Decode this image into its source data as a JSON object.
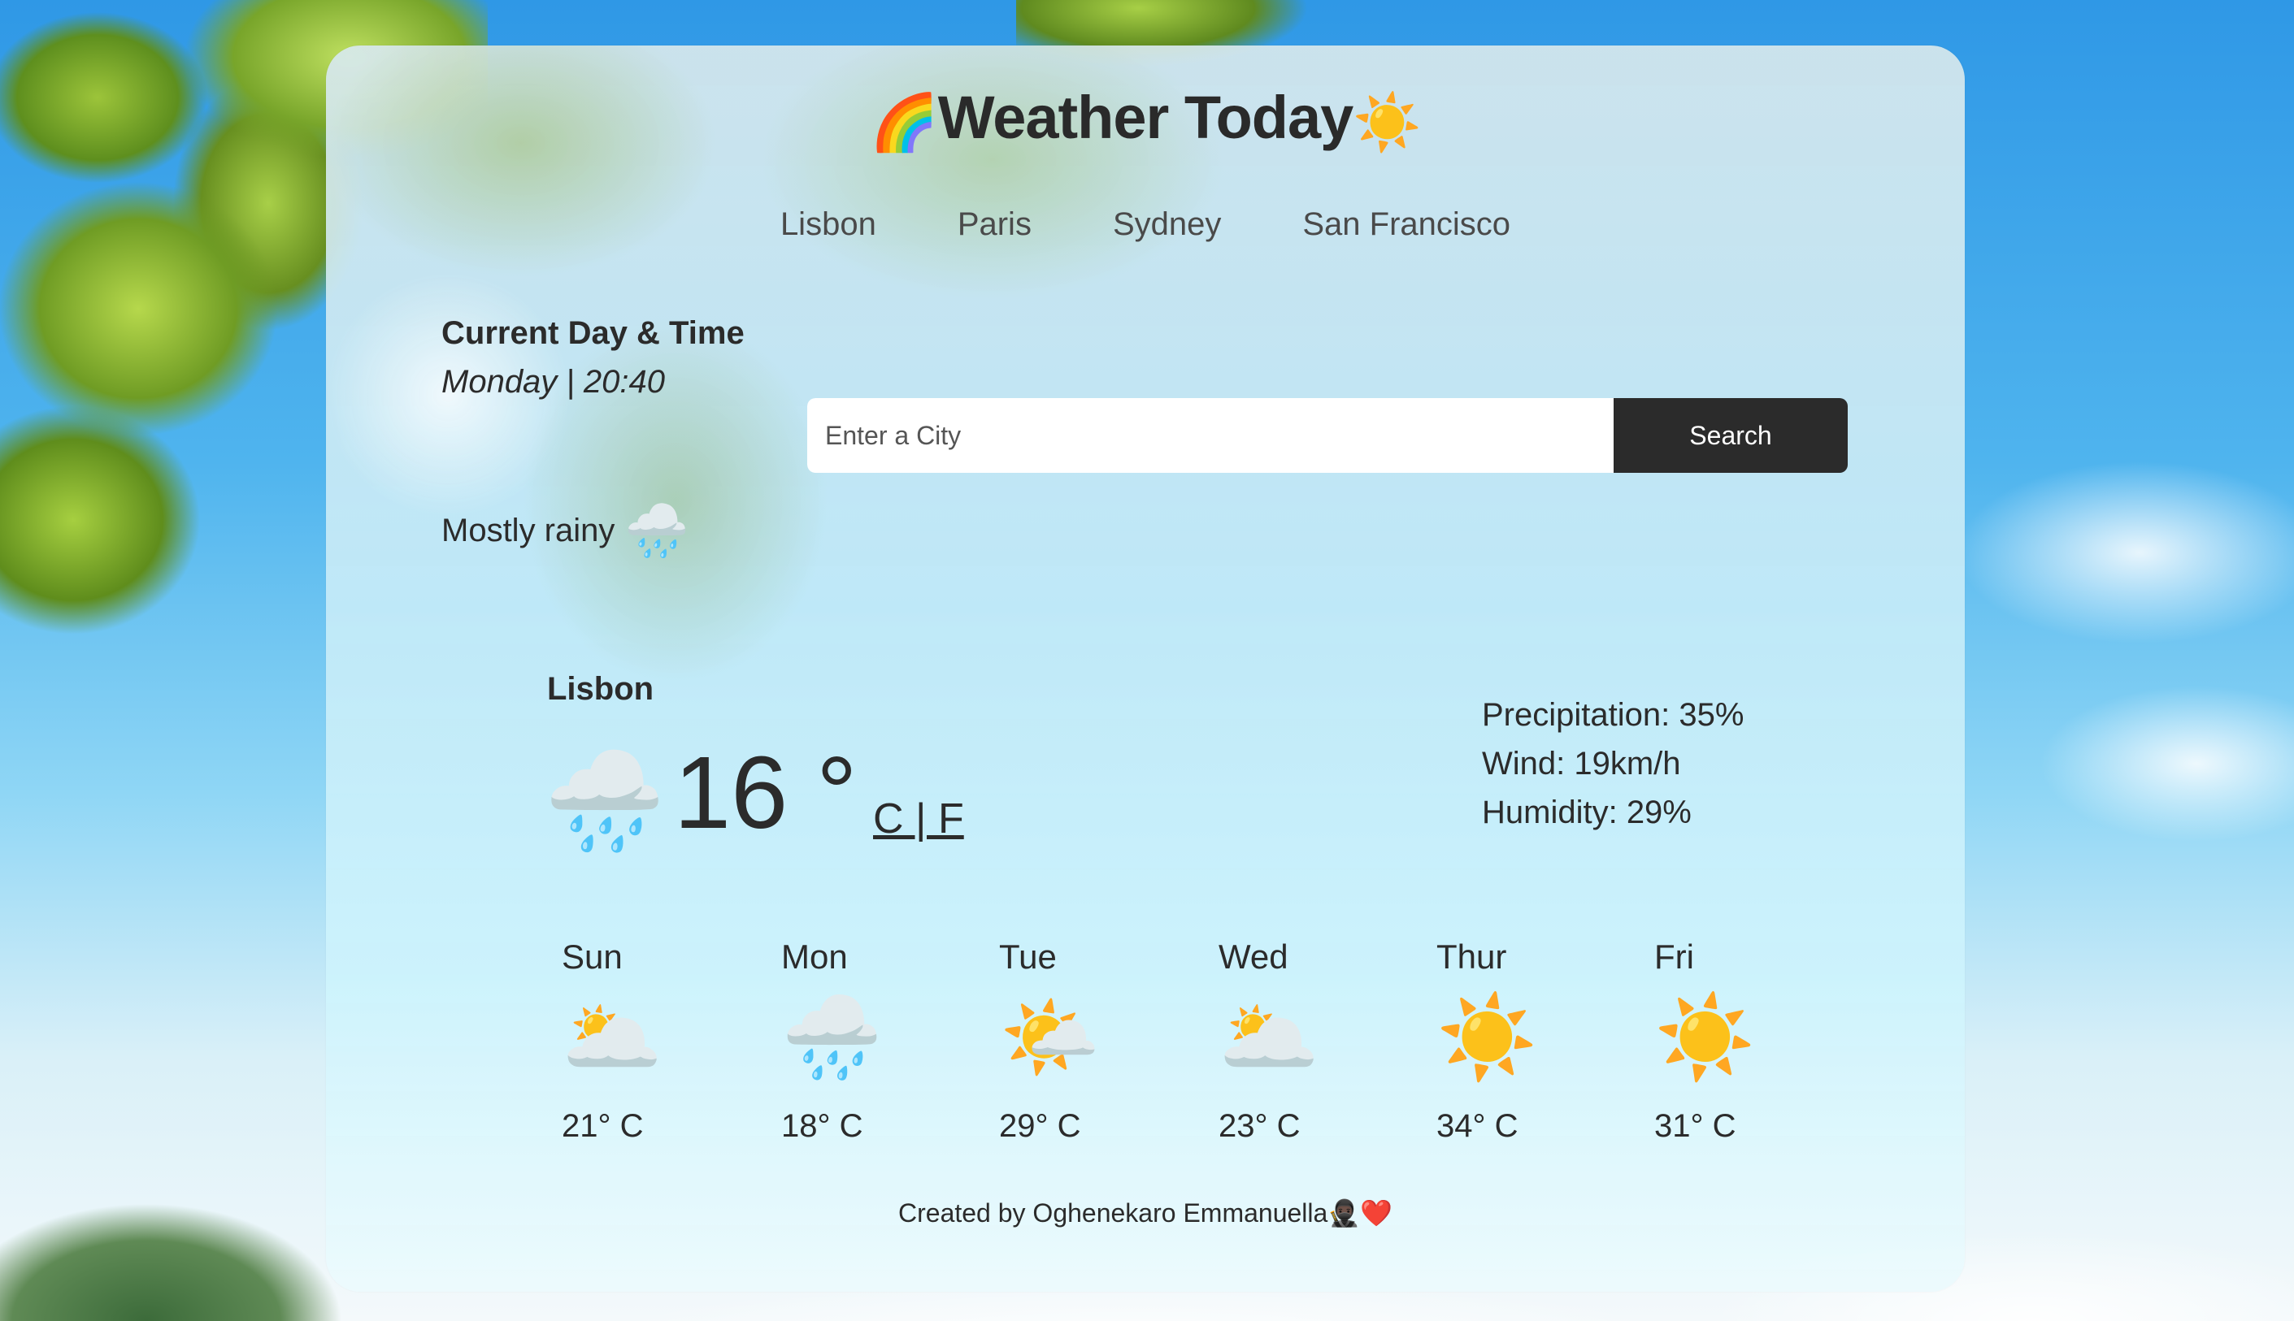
{
  "app": {
    "title": "Weather Today",
    "title_icon_left": "🌈",
    "title_icon_right": "☀️"
  },
  "nav": {
    "cities": [
      "Lisbon",
      "Paris",
      "Sydney",
      "San Francisco"
    ]
  },
  "current": {
    "label": "Current Day & Time",
    "value": "Monday | 20:40",
    "condition": "Mostly rainy",
    "condition_icon": "🌧️"
  },
  "search": {
    "placeholder": "Enter a City",
    "value": "",
    "button_label": "Search"
  },
  "weather": {
    "city": "Lisbon",
    "icon": "🌧️",
    "temperature": "16 °",
    "units": "C | F",
    "precipitation": "Precipitation: 35%",
    "wind": "Wind: 19km/h",
    "humidity": "Humidity: 29%"
  },
  "forecast": [
    {
      "day": "Sun",
      "icon": "🌥️",
      "temp": "21° C"
    },
    {
      "day": "Mon",
      "icon": "🌧️",
      "temp": "18° C"
    },
    {
      "day": "Tue",
      "icon": "🌤️",
      "temp": "29° C"
    },
    {
      "day": "Wed",
      "icon": "🌥️",
      "temp": "23° C"
    },
    {
      "day": "Thur",
      "icon": "☀️",
      "temp": "34° C"
    },
    {
      "day": "Fri",
      "icon": "☀️",
      "temp": "31° C"
    }
  ],
  "footer": {
    "text": "Created by Oghenekaro Emmanuella🥷🏿❤️"
  },
  "colors": {
    "button_bg": "#2b2b2b",
    "text": "#2b2b2b",
    "sky": "#2f98e6"
  }
}
